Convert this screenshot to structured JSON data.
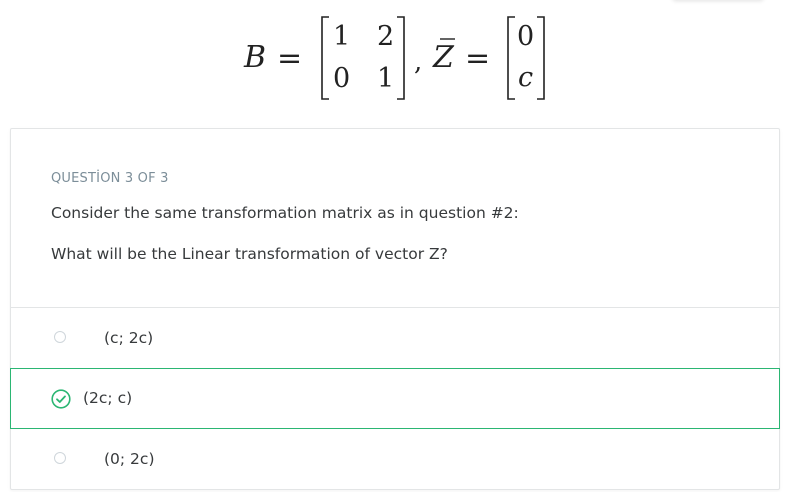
{
  "equation": {
    "b_symbol": "B",
    "equals": "=",
    "matrix_b": [
      [
        "1",
        "2"
      ],
      [
        "0",
        "1"
      ]
    ],
    "comma": ",",
    "z_symbol": "Z",
    "vector_z": [
      "0",
      "c"
    ]
  },
  "question": {
    "counter": "QUESTİON 3 OF 3",
    "text_line1": "Consider the same transformation matrix as in question #2:",
    "text_line2": "What will be the Linear transformation of vector Z?"
  },
  "options": [
    {
      "label": "(c; 2c)",
      "state": "unselected"
    },
    {
      "label": "(2c; c)",
      "state": "correct"
    },
    {
      "label": "(0; 2c)",
      "state": "unselected"
    }
  ],
  "colors": {
    "correct": "#2bb673",
    "counter": "#7c8e99",
    "text": "#373a3c"
  }
}
